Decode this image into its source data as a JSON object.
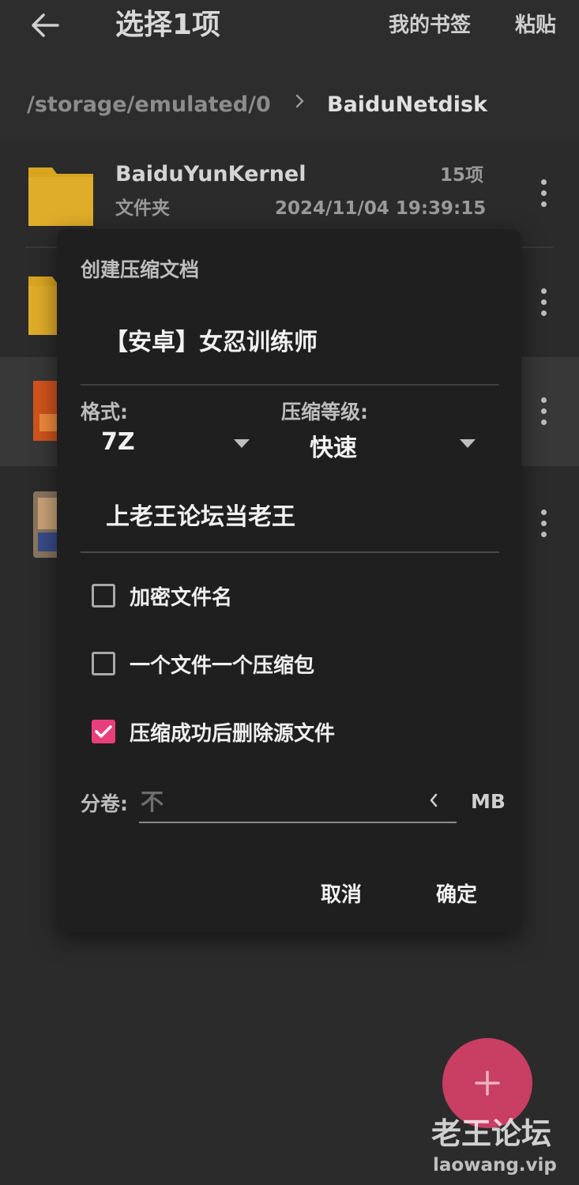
{
  "appbar": {
    "title": "选择1项",
    "bookmarks_label": "我的书签",
    "paste_label": "粘贴",
    "back_icon": "arrow-left-icon"
  },
  "breadcrumb": {
    "root": "/storage/emulated/0",
    "separator_icon": "chevron-right-icon",
    "current": "BaiduNetdisk"
  },
  "files": [
    {
      "name": "BaiduYunKernel",
      "type": "文件夹",
      "count": "15项",
      "modified": "2024/11/04 19:39:15",
      "icon": "folder-icon"
    }
  ],
  "dialog": {
    "title": "创建压缩文档",
    "archive_name": "【安卓】女忍训练师",
    "format_label": "格式:",
    "format_value": "7Z",
    "level_label": "压缩等级:",
    "level_value": "快速",
    "password_value": "上老王论坛当老王",
    "options": [
      {
        "label": "加密文件名",
        "checked": false
      },
      {
        "label": "一个文件一个压缩包",
        "checked": false
      },
      {
        "label": "压缩成功后删除源文件",
        "checked": true
      }
    ],
    "split_label": "分卷:",
    "split_placeholder": "不",
    "split_unit": "MB",
    "cancel_label": "取消",
    "ok_label": "确定"
  },
  "fab": {
    "icon": "plus-icon"
  },
  "watermark": {
    "brand": "老王论坛",
    "url": "laowang.vip"
  },
  "colors": {
    "accent": "#e83e7a",
    "fab": "#c93e63",
    "background": "#2b2b2b",
    "dialog": "#1f1f1f",
    "folder": "#d9a521"
  }
}
